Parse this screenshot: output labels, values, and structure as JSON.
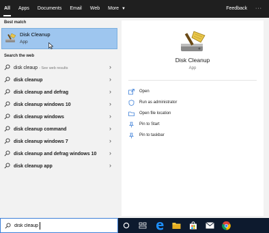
{
  "topnav": {
    "tabs": [
      {
        "label": "All",
        "active": true
      },
      {
        "label": "Apps",
        "active": false
      },
      {
        "label": "Documents",
        "active": false
      },
      {
        "label": "Email",
        "active": false
      },
      {
        "label": "Web",
        "active": false
      },
      {
        "label": "More",
        "active": false,
        "icon": "caret-down-icon"
      }
    ],
    "feedback_label": "Feedback",
    "more_options_label": "···"
  },
  "best_match": {
    "section_label": "Best match",
    "title": "Disk Cleanup",
    "type": "App",
    "icon": "disk-cleanup-icon"
  },
  "web": {
    "section_label": "Search the web",
    "items": [
      {
        "text": "disk cleaup",
        "hint": "- See web results"
      },
      {
        "text": "disk cleanup"
      },
      {
        "text": "disk cleanup and defrag"
      },
      {
        "text": "disk cleanup windows 10"
      },
      {
        "text": "disk cleanup windows"
      },
      {
        "text": "disk cleanup command"
      },
      {
        "text": "disk cleanup windows 7"
      },
      {
        "text": "disk cleanup and defrag windows 10"
      },
      {
        "text": "disk cleanup app"
      }
    ]
  },
  "details": {
    "title": "Disk Cleanup",
    "type": "App",
    "actions": [
      {
        "label": "Open",
        "icon": "open-icon"
      },
      {
        "label": "Run as administrator",
        "icon": "shield-icon"
      },
      {
        "label": "Open file location",
        "icon": "folder-icon"
      },
      {
        "label": "Pin to Start",
        "icon": "pin-icon"
      },
      {
        "label": "Pin to taskbar",
        "icon": "pin-icon"
      }
    ]
  },
  "search": {
    "value": "disk cleaup"
  },
  "taskbar": {
    "icons": [
      "cortana-icon",
      "task-view-icon",
      "edge-icon",
      "file-explorer-icon",
      "store-icon",
      "mail-icon",
      "chrome-icon"
    ]
  },
  "colors": {
    "accent": "#3c7fd8",
    "selected_bg": "#9ec6ef",
    "nav_bg": "#1f1f1f",
    "taskbar_bg": "#0d1a2e"
  }
}
